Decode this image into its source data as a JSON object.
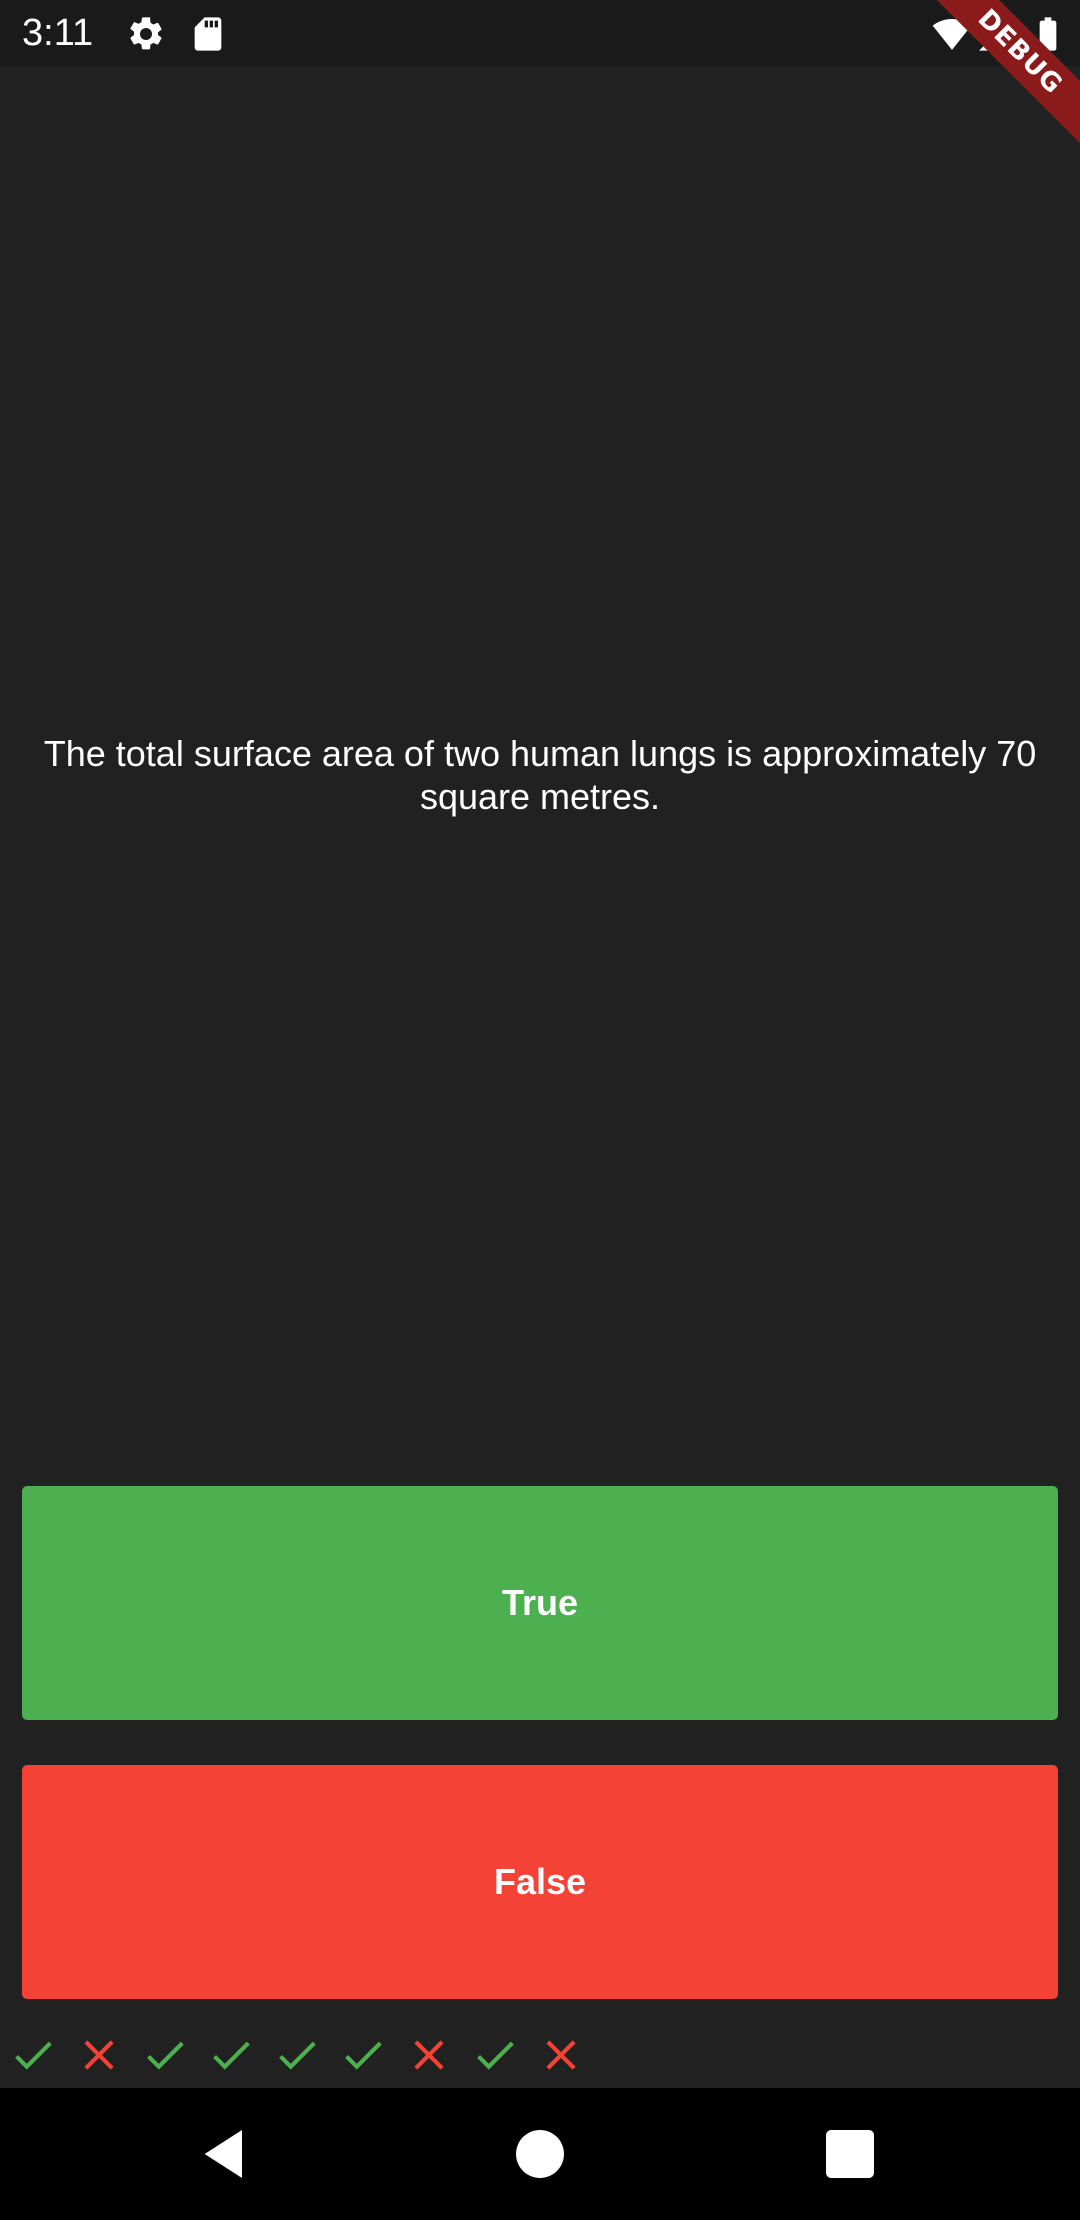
{
  "status_bar": {
    "time": "3:11",
    "icons": [
      "gear-icon",
      "sd-card-icon",
      "wifi-icon",
      "signal-icon",
      "battery-icon"
    ],
    "debug_label": "DEBUG"
  },
  "question": {
    "text": "The total surface area of two human lungs is approximately 70 square metres."
  },
  "buttons": {
    "true_label": "True",
    "false_label": "False",
    "true_color": "#4caf50",
    "false_color": "#f44336"
  },
  "score_keeper": [
    "correct",
    "wrong",
    "correct",
    "correct",
    "correct",
    "correct",
    "wrong",
    "correct",
    "wrong"
  ],
  "colors": {
    "background": "#212121",
    "correct": "#4caf50",
    "wrong": "#f44336"
  },
  "nav_bar": {
    "buttons": [
      "back-icon",
      "home-icon",
      "recents-icon"
    ]
  }
}
